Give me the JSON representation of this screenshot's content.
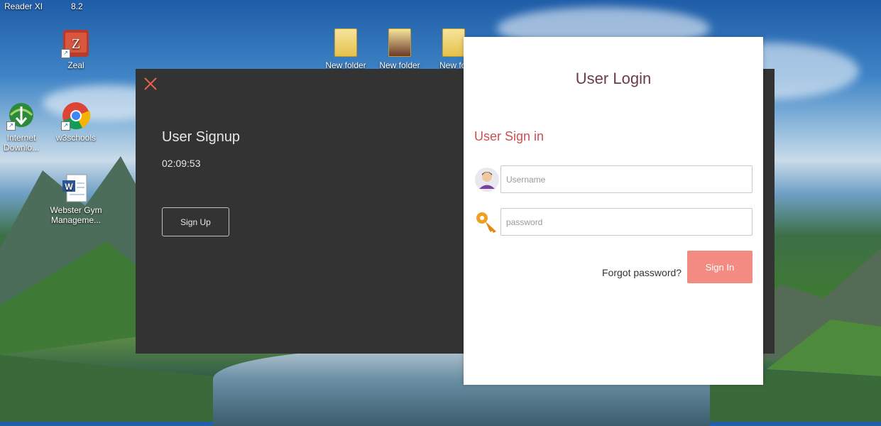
{
  "desktop": {
    "top_labels": [
      "Reader XI",
      "8.2"
    ],
    "icons": [
      {
        "label": "Zeal"
      },
      {
        "label": "Internet Downlo..."
      },
      {
        "label": "w3schools"
      },
      {
        "label": "Webster Gym Manageme..."
      },
      {
        "label": "New folder"
      },
      {
        "label": "New folder"
      },
      {
        "label": "New fol"
      }
    ]
  },
  "signup": {
    "title": "User Signup",
    "time": "02:09:53",
    "button_label": "Sign Up",
    "close_color": "#e8604c"
  },
  "login": {
    "title": "User Login",
    "subtitle": "User Sign in",
    "username_placeholder": "Username",
    "password_placeholder": "password",
    "forgot_label": "Forgot password?",
    "signin_label": "Sign In",
    "accent": "#f28b82"
  }
}
